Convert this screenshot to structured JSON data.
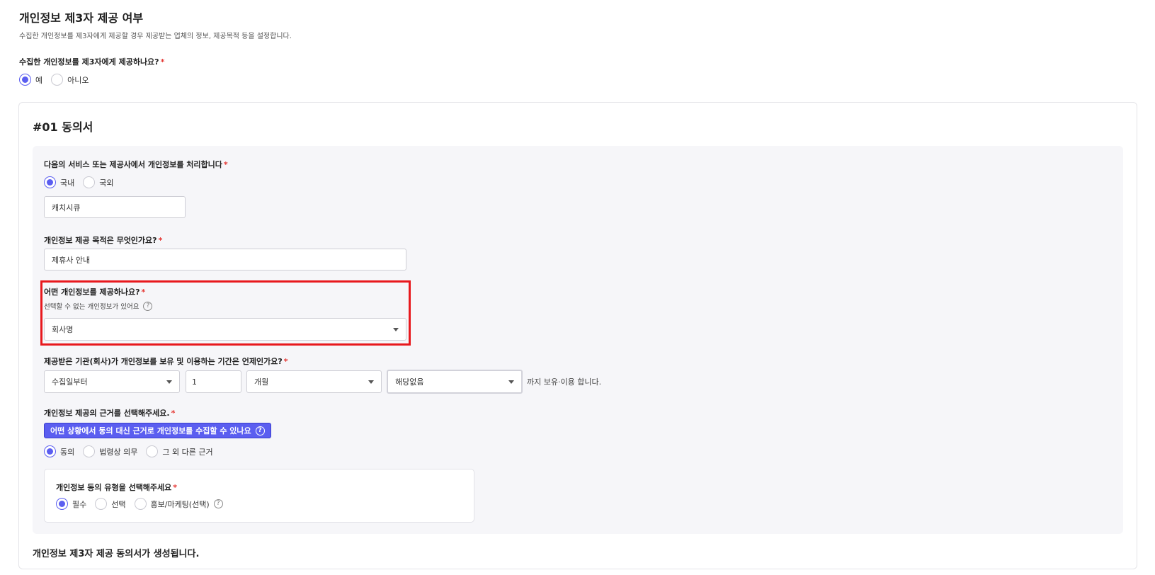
{
  "section": {
    "title": "개인정보 제3자 제공 여부",
    "description": "수집한 개인정보를 제3자에게 제공할 경우 제공받는 업체의 정보, 제공목적 등을 설정합니다."
  },
  "provide_question": {
    "label": "수집한 개인정보를 제3자에게 제공하나요?",
    "required_mark": "*",
    "options": [
      "예",
      "아니오"
    ],
    "selected": "예"
  },
  "consent": {
    "title": "#01 동의서",
    "processor": {
      "label": "다음의 서비스 또는 제공사에서 개인정보를 처리합니다",
      "required_mark": "*",
      "options": [
        "국내",
        "국외"
      ],
      "selected": "국내",
      "input_value": "캐치시큐"
    },
    "purpose": {
      "label": "개인정보 제공 목적은 무엇인가요?",
      "required_mark": "*",
      "input_value": "제휴사 안내"
    },
    "items": {
      "label": "어떤 개인정보를 제공하나요?",
      "required_mark": "*",
      "hint": "선택할 수 없는 개인정보가 있어요",
      "help_glyph": "?",
      "select_value": "회사명"
    },
    "retention": {
      "label": "제공받은 기관(회사)가 개인정보를 보유 및 이용하는 기간은 언제인가요?",
      "required_mark": "*",
      "start_select": "수집일부터",
      "amount_value": "1",
      "unit_select": "개월",
      "extra_select": "해당없음",
      "suffix": "까지 보유·이용 합니다."
    },
    "basis": {
      "label": "개인정보 제공의 근거를 선택해주세요.",
      "required_mark": "*",
      "badge_text": "어떤 상황에서 동의 대신 근거로 개인정보를 수집할 수 있나요",
      "help_glyph": "?",
      "options": [
        "동의",
        "법령상 의무",
        "그 외 다른 근거"
      ],
      "selected": "동의"
    },
    "consent_type": {
      "label": "개인정보 동의 유형을 선택해주세요",
      "required_mark": "*",
      "options": [
        "필수",
        "선택",
        "홍보/마케팅(선택)"
      ],
      "selected": "필수",
      "help_glyph": "?"
    }
  },
  "footer": {
    "text": "개인정보 제3자 제공 동의서가 생성됩니다."
  },
  "colors": {
    "accent": "#5b5ef0",
    "highlight": "#e8191e",
    "required": "#e53935"
  }
}
